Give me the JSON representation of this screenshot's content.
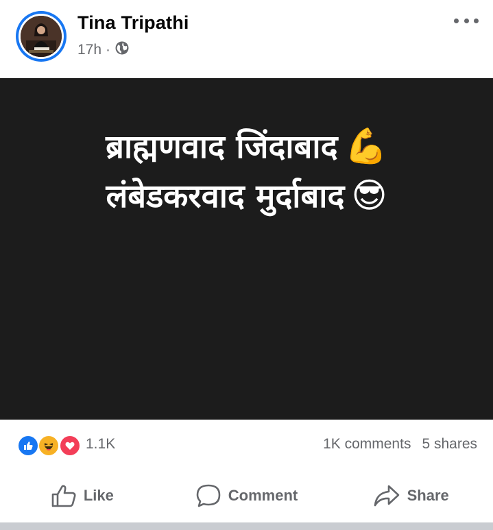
{
  "post": {
    "author": "Tina Tripathi",
    "time": "17h",
    "separator": "·",
    "audience_icon": "globe-icon",
    "options_icon": "more-options-icon",
    "image_text": {
      "line1": "ब्राह्मणवाद जिंदाबाद",
      "line1_emoji": "💪",
      "line2": "लंबेडकरवाद मुर्दाबाद",
      "line2_emoji": "😎"
    },
    "background_color": "#1c1c1c"
  },
  "reactions": {
    "icons": [
      "like-reaction-icon",
      "haha-reaction-icon",
      "love-reaction-icon"
    ],
    "count": "1.1K",
    "comments": "1K comments",
    "shares": "5 shares"
  },
  "actions": {
    "like": "Like",
    "comment": "Comment",
    "share": "Share"
  },
  "colors": {
    "brand_blue": "#1877f2",
    "secondary_text": "#65676b",
    "love_red": "#f33e58",
    "haha_yellow": "#f7b125"
  }
}
